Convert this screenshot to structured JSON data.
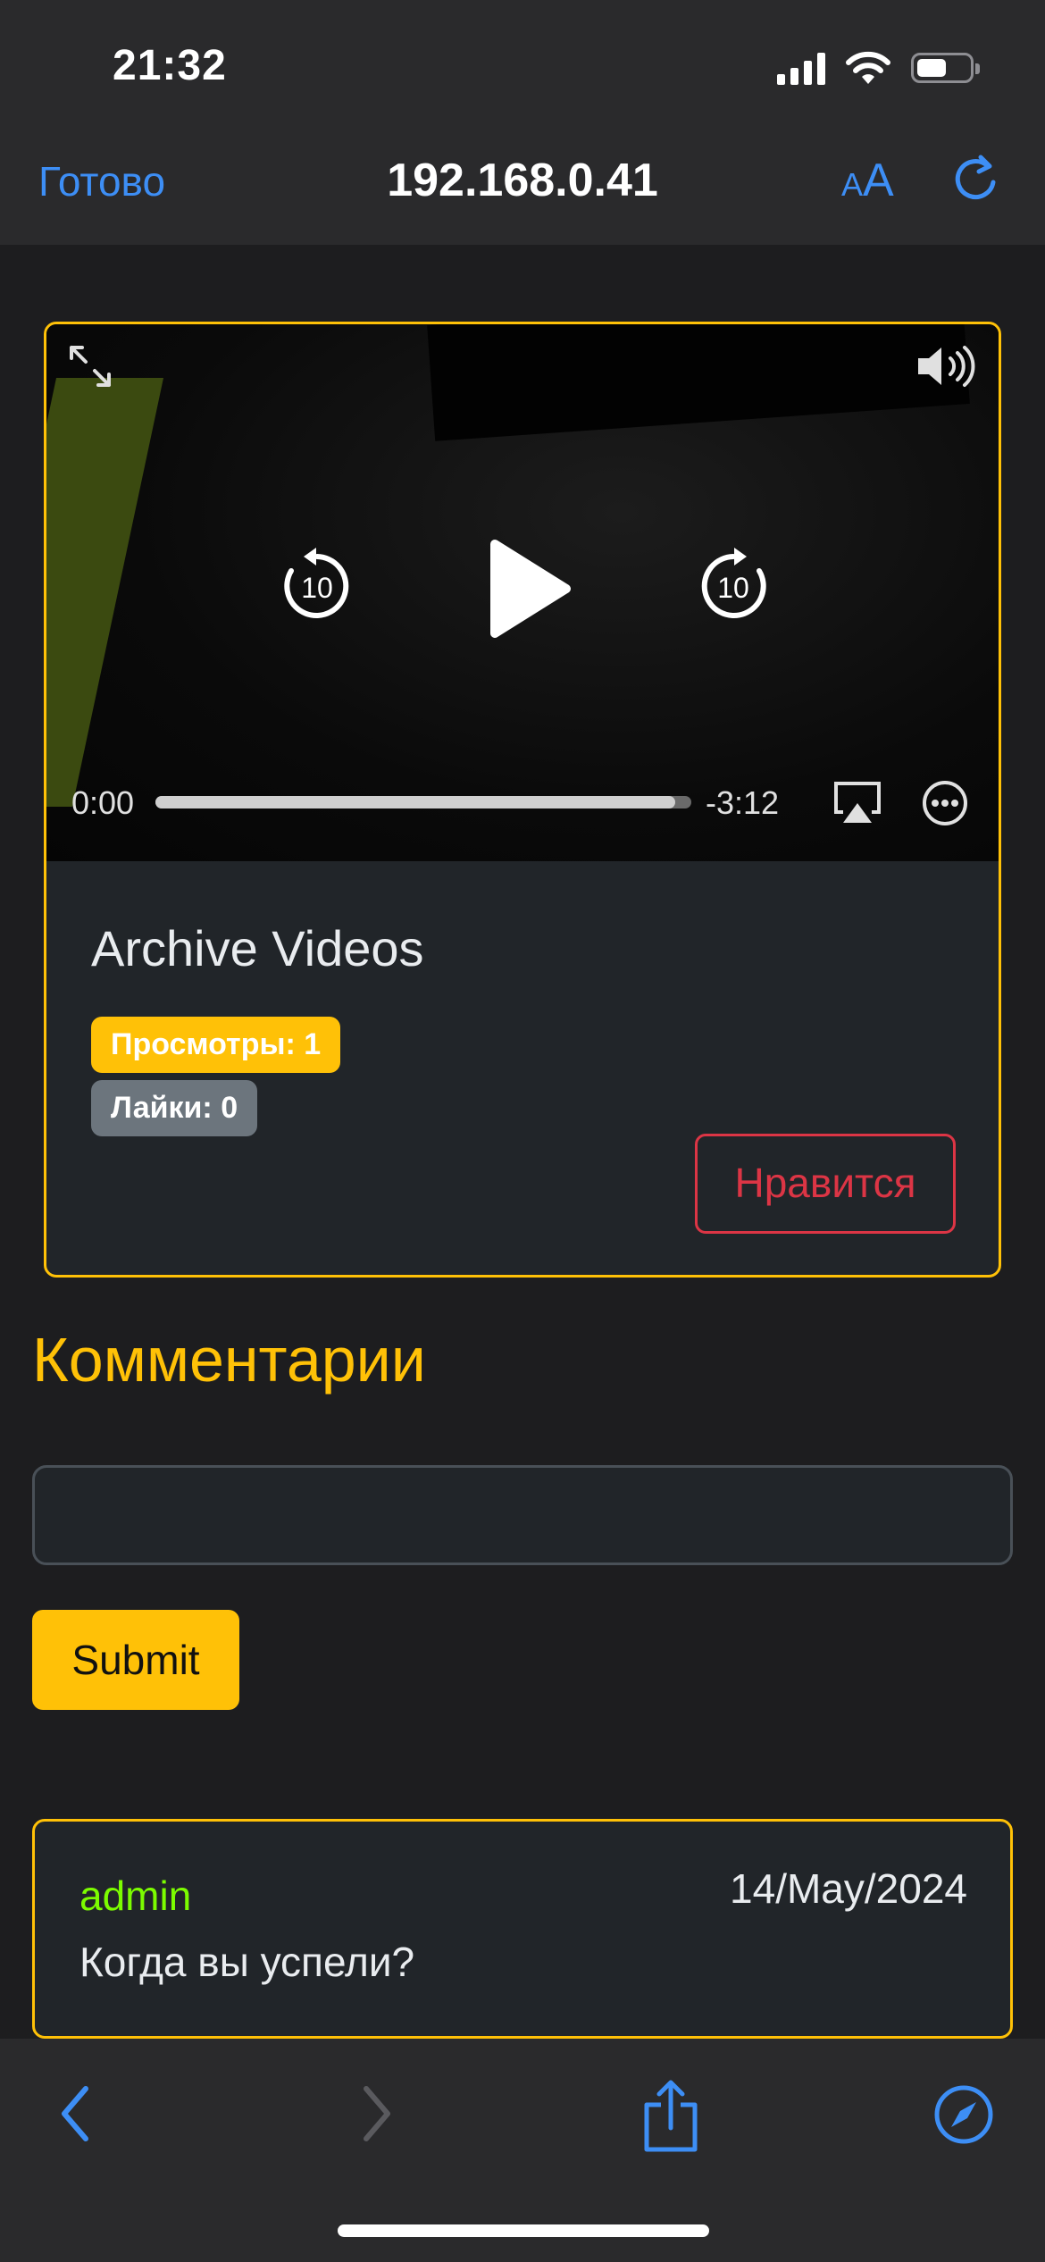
{
  "status_bar": {
    "time": "21:32"
  },
  "browser": {
    "done_label": "Готово",
    "url": "192.168.0.41",
    "text_size_label": "AA"
  },
  "video": {
    "current_time": "0:00",
    "remaining_time": "-3:12",
    "progress_fraction": 0.97,
    "skip_back_label": "10",
    "skip_forward_label": "10"
  },
  "card": {
    "title": "Archive Videos",
    "views_badge": "Просмотры: 1",
    "likes_badge": "Лайки: 0",
    "like_button": "Нравится"
  },
  "comments": {
    "heading": "Комментарии",
    "input_value": "",
    "submit_label": "Submit",
    "items": [
      {
        "user": "admin",
        "date": "14/May/2024",
        "text": "Когда вы успели?"
      }
    ]
  },
  "colors": {
    "accent": "#ffc107",
    "danger": "#dc3545",
    "ios_blue": "#3d8ef5",
    "username": "#7cfc00"
  }
}
